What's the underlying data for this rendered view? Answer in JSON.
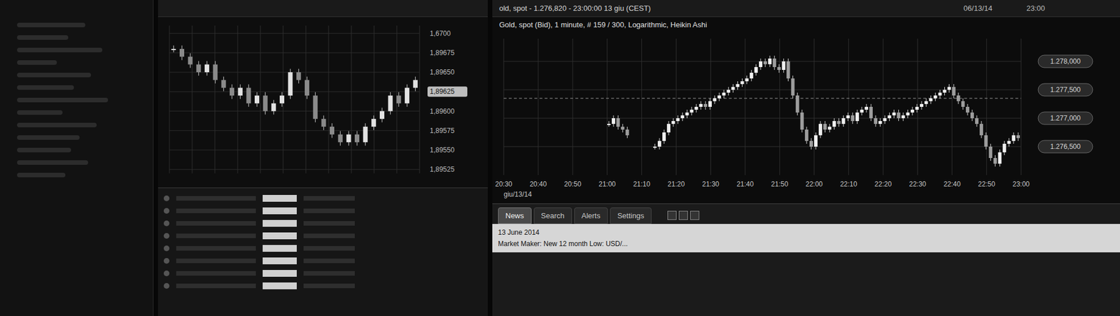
{
  "header": {
    "title_partial": "old, spot - 1.276,820 - 23:00:00  13 giu (CEST)",
    "date": "06/13/14",
    "time": "23:00"
  },
  "left_chart": {
    "y_ticks": [
      {
        "label": "1,6700",
        "value": 1.897,
        "highlighted": false
      },
      {
        "label": "1,89675",
        "value": 1.89675,
        "highlighted": false
      },
      {
        "label": "1,89650",
        "value": 1.8965,
        "highlighted": false
      },
      {
        "label": "1,89625",
        "value": 1.89625,
        "highlighted": true
      },
      {
        "label": "1,89600",
        "value": 1.896,
        "highlighted": false
      },
      {
        "label": "1,89575",
        "value": 1.89575,
        "highlighted": false
      },
      {
        "label": "1,89550",
        "value": 1.8955,
        "highlighted": false
      },
      {
        "label": "1,89525",
        "value": 1.89525,
        "highlighted": false
      }
    ],
    "series": [
      1.8968,
      1.8967,
      1.8966,
      1.8965,
      1.8966,
      1.8964,
      1.8963,
      1.8962,
      1.8963,
      1.8961,
      1.8962,
      1.896,
      1.8961,
      1.8962,
      1.8965,
      1.8964,
      1.8962,
      1.8959,
      1.8958,
      1.8957,
      1.8956,
      1.8957,
      1.8956,
      1.8958,
      1.8959,
      1.896,
      1.8962,
      1.8961,
      1.8963,
      1.8964
    ]
  },
  "right_chart": {
    "title": "Gold, spot (Bid), 1 minute, # 159 / 300, Logarithmic, Heikin Ashi",
    "x_ticks": [
      "20:30",
      "20:40",
      "20:50",
      "21:00",
      "21:10",
      "21:20",
      "21:30",
      "21:40",
      "21:50",
      "22:00",
      "22:10",
      "22:20",
      "22:30",
      "22:40",
      "22:50",
      "23:00"
    ],
    "date_label": "giu/13/14",
    "y_ticks": [
      {
        "label": "1.278,000",
        "value": 1278.0
      },
      {
        "label": "1.277,500",
        "value": 1277.5
      },
      {
        "label": "1.277,000",
        "value": 1277.0
      },
      {
        "label": "1.276,500",
        "value": 1276.5
      }
    ],
    "dashed_level": 1277.35,
    "series": [
      1276.9,
      1277.0,
      1276.85,
      1276.8,
      1276.7,
      null,
      null,
      null,
      null,
      null,
      1276.5,
      1276.6,
      1276.75,
      1276.9,
      1276.95,
      1277.0,
      1277.05,
      1277.1,
      1277.15,
      1277.2,
      1277.25,
      1277.2,
      1277.3,
      1277.35,
      1277.4,
      1277.45,
      1277.5,
      1277.55,
      1277.6,
      1277.65,
      1277.7,
      1277.8,
      1277.9,
      1278.0,
      1277.95,
      1278.05,
      1277.9,
      1277.85,
      1278.0,
      1277.7,
      1277.4,
      1277.1,
      1276.8,
      1276.6,
      1276.5,
      1276.7,
      1276.9,
      1276.8,
      1276.85,
      1276.95,
      1276.9,
      1277.0,
      1277.05,
      1276.95,
      1277.1,
      1277.15,
      1277.2,
      1277.0,
      1276.9,
      1276.95,
      1277.0,
      1277.05,
      1277.1,
      1277.0,
      1277.05,
      1277.1,
      1277.15,
      1277.2,
      1277.25,
      1277.3,
      1277.35,
      1277.4,
      1277.45,
      1277.5,
      1277.55,
      1277.4,
      1277.3,
      1277.2,
      1277.1,
      1277.0,
      1276.9,
      1276.7,
      1276.5,
      1276.3,
      1276.2,
      1276.4,
      1276.55,
      1276.6,
      1276.7,
      1276.65
    ]
  },
  "news_panel": {
    "tabs": [
      {
        "label": "News",
        "selected": true
      },
      {
        "label": "Search",
        "selected": false
      },
      {
        "label": "Alerts",
        "selected": false
      },
      {
        "label": "Settings",
        "selected": false
      }
    ],
    "date": "13 June 2014",
    "headline": "Market Maker: New 12 month Low: USD/..."
  }
}
